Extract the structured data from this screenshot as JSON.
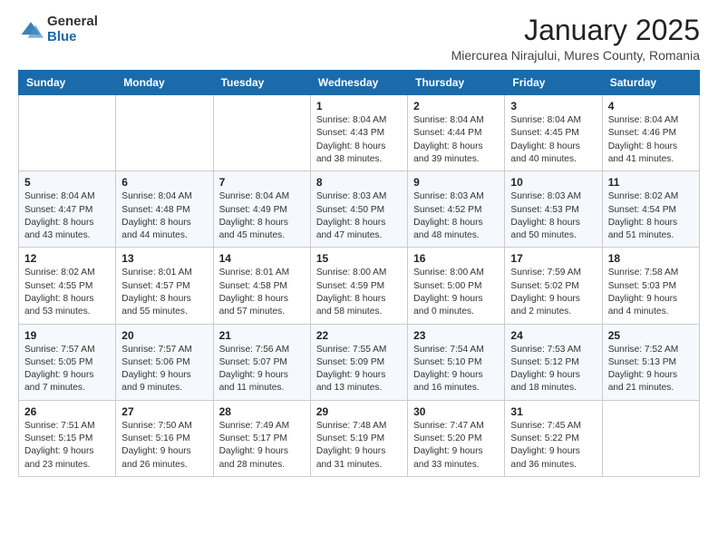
{
  "logo": {
    "general": "General",
    "blue": "Blue"
  },
  "title": "January 2025",
  "location": "Miercurea Nirajului, Mures County, Romania",
  "days_of_week": [
    "Sunday",
    "Monday",
    "Tuesday",
    "Wednesday",
    "Thursday",
    "Friday",
    "Saturday"
  ],
  "weeks": [
    [
      {
        "day": "",
        "info": ""
      },
      {
        "day": "",
        "info": ""
      },
      {
        "day": "",
        "info": ""
      },
      {
        "day": "1",
        "info": "Sunrise: 8:04 AM\nSunset: 4:43 PM\nDaylight: 8 hours\nand 38 minutes."
      },
      {
        "day": "2",
        "info": "Sunrise: 8:04 AM\nSunset: 4:44 PM\nDaylight: 8 hours\nand 39 minutes."
      },
      {
        "day": "3",
        "info": "Sunrise: 8:04 AM\nSunset: 4:45 PM\nDaylight: 8 hours\nand 40 minutes."
      },
      {
        "day": "4",
        "info": "Sunrise: 8:04 AM\nSunset: 4:46 PM\nDaylight: 8 hours\nand 41 minutes."
      }
    ],
    [
      {
        "day": "5",
        "info": "Sunrise: 8:04 AM\nSunset: 4:47 PM\nDaylight: 8 hours\nand 43 minutes."
      },
      {
        "day": "6",
        "info": "Sunrise: 8:04 AM\nSunset: 4:48 PM\nDaylight: 8 hours\nand 44 minutes."
      },
      {
        "day": "7",
        "info": "Sunrise: 8:04 AM\nSunset: 4:49 PM\nDaylight: 8 hours\nand 45 minutes."
      },
      {
        "day": "8",
        "info": "Sunrise: 8:03 AM\nSunset: 4:50 PM\nDaylight: 8 hours\nand 47 minutes."
      },
      {
        "day": "9",
        "info": "Sunrise: 8:03 AM\nSunset: 4:52 PM\nDaylight: 8 hours\nand 48 minutes."
      },
      {
        "day": "10",
        "info": "Sunrise: 8:03 AM\nSunset: 4:53 PM\nDaylight: 8 hours\nand 50 minutes."
      },
      {
        "day": "11",
        "info": "Sunrise: 8:02 AM\nSunset: 4:54 PM\nDaylight: 8 hours\nand 51 minutes."
      }
    ],
    [
      {
        "day": "12",
        "info": "Sunrise: 8:02 AM\nSunset: 4:55 PM\nDaylight: 8 hours\nand 53 minutes."
      },
      {
        "day": "13",
        "info": "Sunrise: 8:01 AM\nSunset: 4:57 PM\nDaylight: 8 hours\nand 55 minutes."
      },
      {
        "day": "14",
        "info": "Sunrise: 8:01 AM\nSunset: 4:58 PM\nDaylight: 8 hours\nand 57 minutes."
      },
      {
        "day": "15",
        "info": "Sunrise: 8:00 AM\nSunset: 4:59 PM\nDaylight: 8 hours\nand 58 minutes."
      },
      {
        "day": "16",
        "info": "Sunrise: 8:00 AM\nSunset: 5:00 PM\nDaylight: 9 hours\nand 0 minutes."
      },
      {
        "day": "17",
        "info": "Sunrise: 7:59 AM\nSunset: 5:02 PM\nDaylight: 9 hours\nand 2 minutes."
      },
      {
        "day": "18",
        "info": "Sunrise: 7:58 AM\nSunset: 5:03 PM\nDaylight: 9 hours\nand 4 minutes."
      }
    ],
    [
      {
        "day": "19",
        "info": "Sunrise: 7:57 AM\nSunset: 5:05 PM\nDaylight: 9 hours\nand 7 minutes."
      },
      {
        "day": "20",
        "info": "Sunrise: 7:57 AM\nSunset: 5:06 PM\nDaylight: 9 hours\nand 9 minutes."
      },
      {
        "day": "21",
        "info": "Sunrise: 7:56 AM\nSunset: 5:07 PM\nDaylight: 9 hours\nand 11 minutes."
      },
      {
        "day": "22",
        "info": "Sunrise: 7:55 AM\nSunset: 5:09 PM\nDaylight: 9 hours\nand 13 minutes."
      },
      {
        "day": "23",
        "info": "Sunrise: 7:54 AM\nSunset: 5:10 PM\nDaylight: 9 hours\nand 16 minutes."
      },
      {
        "day": "24",
        "info": "Sunrise: 7:53 AM\nSunset: 5:12 PM\nDaylight: 9 hours\nand 18 minutes."
      },
      {
        "day": "25",
        "info": "Sunrise: 7:52 AM\nSunset: 5:13 PM\nDaylight: 9 hours\nand 21 minutes."
      }
    ],
    [
      {
        "day": "26",
        "info": "Sunrise: 7:51 AM\nSunset: 5:15 PM\nDaylight: 9 hours\nand 23 minutes."
      },
      {
        "day": "27",
        "info": "Sunrise: 7:50 AM\nSunset: 5:16 PM\nDaylight: 9 hours\nand 26 minutes."
      },
      {
        "day": "28",
        "info": "Sunrise: 7:49 AM\nSunset: 5:17 PM\nDaylight: 9 hours\nand 28 minutes."
      },
      {
        "day": "29",
        "info": "Sunrise: 7:48 AM\nSunset: 5:19 PM\nDaylight: 9 hours\nand 31 minutes."
      },
      {
        "day": "30",
        "info": "Sunrise: 7:47 AM\nSunset: 5:20 PM\nDaylight: 9 hours\nand 33 minutes."
      },
      {
        "day": "31",
        "info": "Sunrise: 7:45 AM\nSunset: 5:22 PM\nDaylight: 9 hours\nand 36 minutes."
      },
      {
        "day": "",
        "info": ""
      }
    ]
  ]
}
